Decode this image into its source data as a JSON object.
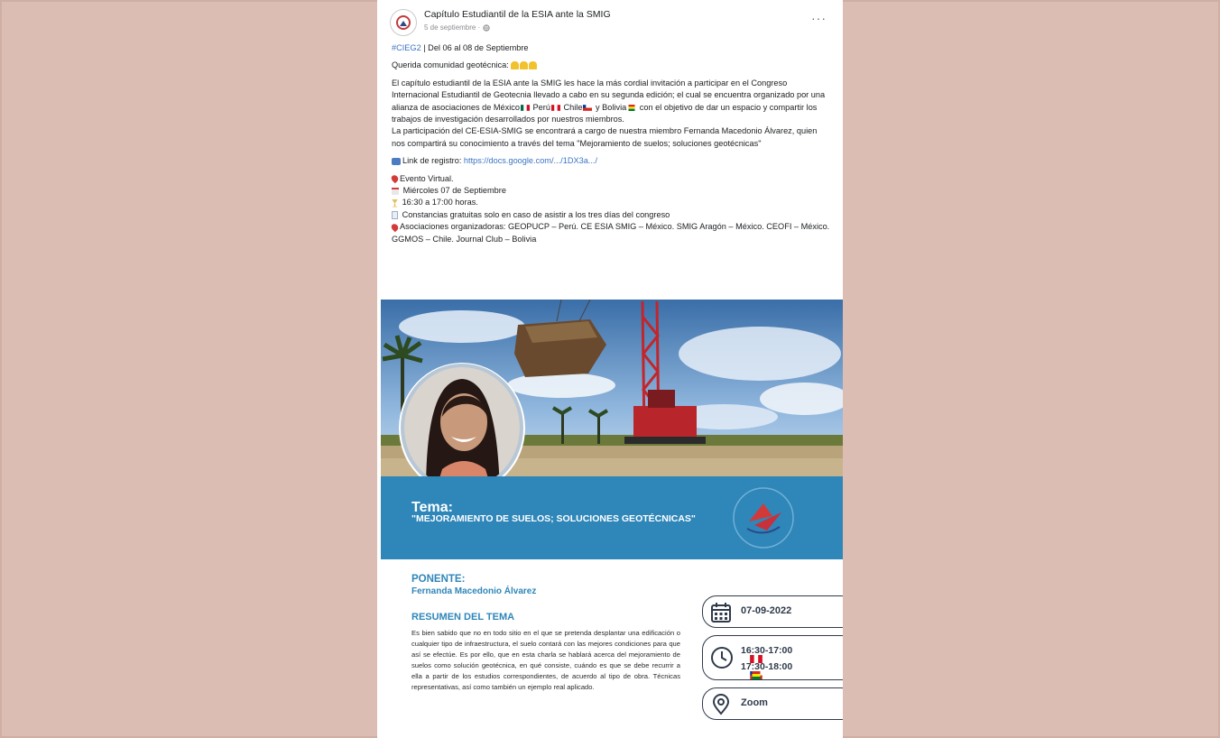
{
  "post": {
    "page_name": "Capítulo Estudiantil de la ESIA ante la SMIG",
    "date": "5 de septiembre",
    "visibility_icon": "globe-icon",
    "more_icon": "more-options-icon",
    "more_label": "···",
    "hashtag": "#CIEG2",
    "date_range": " | Del 06 al 08 de Septiembre",
    "greeting": "Querida comunidad geotécnica:",
    "paragraph1": "El capítulo estudiantil de la ESIA ante la SMIG les hace la más cordial invitación a participar en el Congreso Internacional Estudiantil de Geotecnia llevado a cabo en su segunda edición; el cual se encuentra organizado por una alianza de asociaciones de México",
    "peru": " Perú",
    "chile": " Chile",
    "bolivia": " y Bolivia",
    "paragraph1_end": "con el objetivo de dar un espacio y compartir los trabajos de investigación desarrollados por nuestros miembros.",
    "paragraph2": "La participación del CE-ESIA-SMIG se encontrará a cargo de nuestra miembro Fernanda Macedonio Álvarez, quien nos compartirá su conocimiento a través del tema \"Mejoramiento de suelos; soluciones geotécnicas\"",
    "link_label": "Link de registro: ",
    "link_url": "https://docs.google.com/.../1DX3a.../",
    "details": [
      "Evento Virtual.",
      "Miércoles 07 de Septiembre",
      "16:30 a 17:00 horas.",
      "Constancias gratuitas solo en caso de asistir a los tres días del congreso",
      "Asociaciones organizadoras: GEOPUCP – Perú. CE ESIA SMIG – México. SMIG Aragón – México. CEOFI – México. GGMOS – Chile. Journal Club – Bolivia"
    ]
  },
  "flyer": {
    "tema_label": "Tema:",
    "tema_title": "\"MEJORAMIENTO DE SUELOS; SOLUCIONES GEOTÉCNICAS\"",
    "ponente_label": "PONENTE:",
    "ponente_name": "Fernanda Macedonio Álvarez",
    "resumen_label": "RESUMEN DEL TEMA",
    "resumen_text": "Es bien sabido que no en todo sitio en el que se pretenda desplantar una edificación o cualquier tipo de infraestructura, el suelo contará con las mejores condiciones para que así se efectúe. Es por ello, que en esta charla se hablará acerca del mejoramiento de suelos como solución geotécnica, en qué consiste, cuándo es que se debe recurrir a ella a partir de los estudios correspondientes, de acuerdo al tipo de obra. Técnicas representativas, así como también un ejemplo real aplicado.",
    "date": "07-09-2022",
    "time1": "16:30-17:00",
    "time2": "17:30-18:00",
    "platform": "Zoom"
  },
  "colors": {
    "page_bg": "#dcbdb3",
    "accent_blue": "#2f86b9",
    "link_blue": "#3b73c4",
    "text": "#1c1e21"
  }
}
